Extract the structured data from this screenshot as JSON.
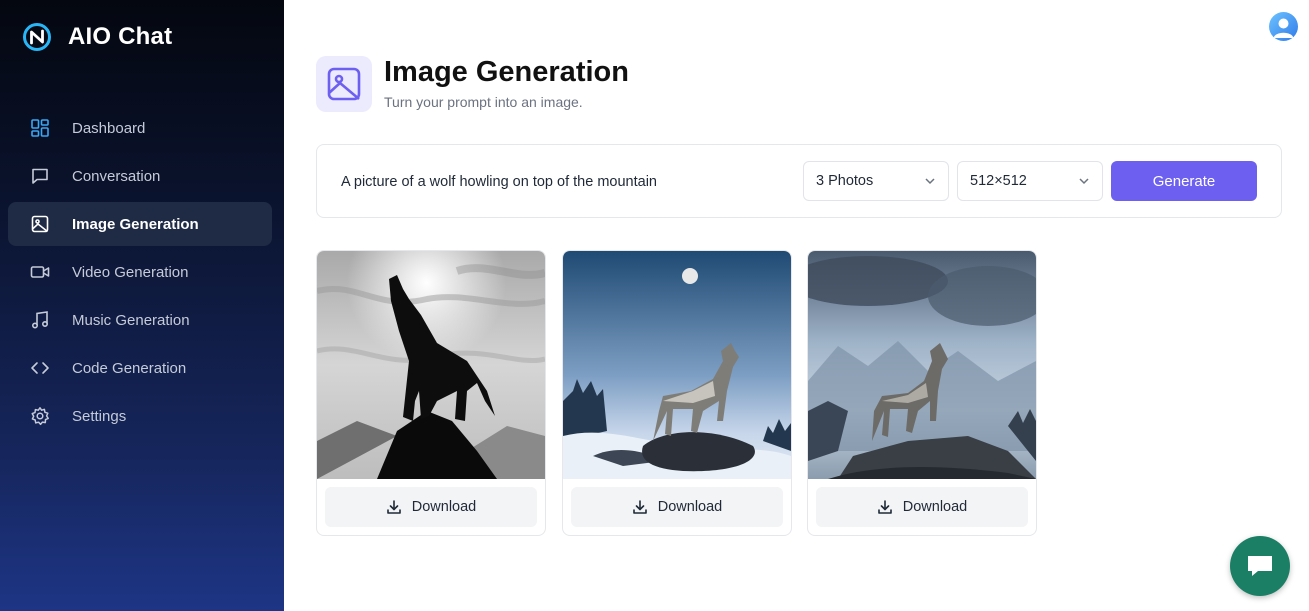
{
  "brand": {
    "name": "AIO Chat",
    "logo_icon": "aio-logo-icon",
    "accent": "#29b6f6"
  },
  "sidebar": {
    "items": [
      {
        "label": "Dashboard",
        "icon": "dashboard-icon",
        "active": false
      },
      {
        "label": "Conversation",
        "icon": "chat-bubble-icon",
        "active": false
      },
      {
        "label": "Image Generation",
        "icon": "image-icon",
        "active": true
      },
      {
        "label": "Video Generation",
        "icon": "video-camera-icon",
        "active": false
      },
      {
        "label": "Music Generation",
        "icon": "music-note-icon",
        "active": false
      },
      {
        "label": "Code Generation",
        "icon": "code-brackets-icon",
        "active": false
      },
      {
        "label": "Settings",
        "icon": "gear-icon",
        "active": false
      }
    ]
  },
  "header": {
    "avatar": "user-avatar-icon"
  },
  "page": {
    "title": "Image Generation",
    "subtitle": "Turn your prompt into an image.",
    "icon": "image-icon"
  },
  "prompt": {
    "text": "A picture of a wolf howling on top of the mountain",
    "photos_select": "3 Photos",
    "size_select": "512×512",
    "generate_label": "Generate",
    "generate_color": "#6d5ff0"
  },
  "results": [
    {
      "download_label": "Download",
      "image": "wolf-monochrome-image"
    },
    {
      "download_label": "Download",
      "image": "wolf-moon-snow-image"
    },
    {
      "download_label": "Download",
      "image": "wolf-cloudy-sky-image"
    }
  ],
  "chat_fab": {
    "icon": "chat-support-icon",
    "color": "#1a7f64"
  }
}
